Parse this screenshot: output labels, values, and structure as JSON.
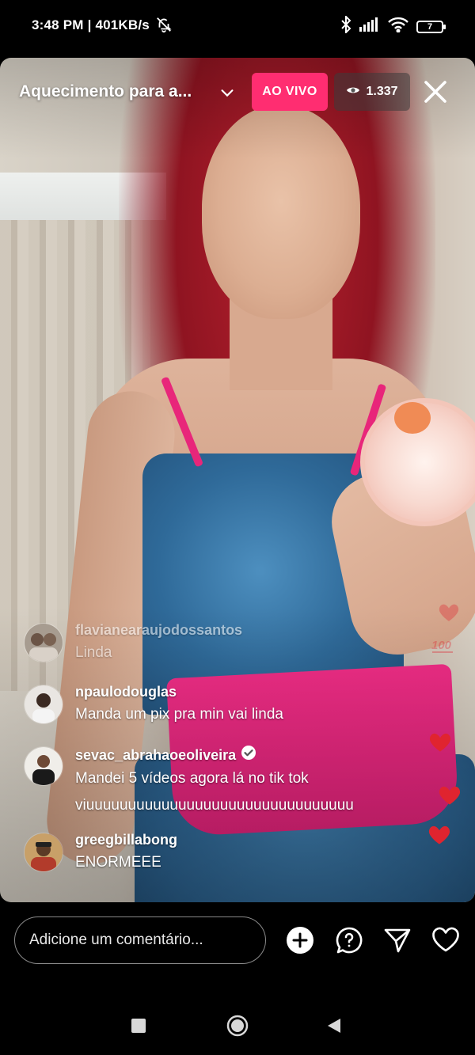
{
  "status_bar": {
    "time": "3:48 PM | 401KB/s",
    "battery": "7"
  },
  "live": {
    "title": "Aquecimento para a...",
    "badge": "AO VIVO",
    "viewers": "1.337"
  },
  "comments": [
    {
      "username": "flavianearaujodossantos",
      "text": "Linda",
      "verified": false,
      "faded": true
    },
    {
      "username": "npaulodouglas",
      "text": "Manda um pix pra min  vai linda",
      "verified": false,
      "faded": false
    },
    {
      "username": "sevac_abrahaoeoliveira",
      "text": "Mandei 5 vídeos agora lá no tik tok",
      "text2": "viuuuuuuuuuuuuuuuuuuuuuuuuuuuuuuuu",
      "verified": true,
      "faded": false
    },
    {
      "username": "greegbillabong",
      "text": "ENORMEEE",
      "verified": false,
      "faded": false
    }
  ],
  "reactions": [
    "heart",
    "hundred",
    "heart",
    "heart",
    "heart"
  ],
  "bottom_bar": {
    "comment_placeholder": "Adicione um comentário..."
  },
  "colors": {
    "live_badge": "#ff2d71",
    "heart": "#e0242f"
  }
}
